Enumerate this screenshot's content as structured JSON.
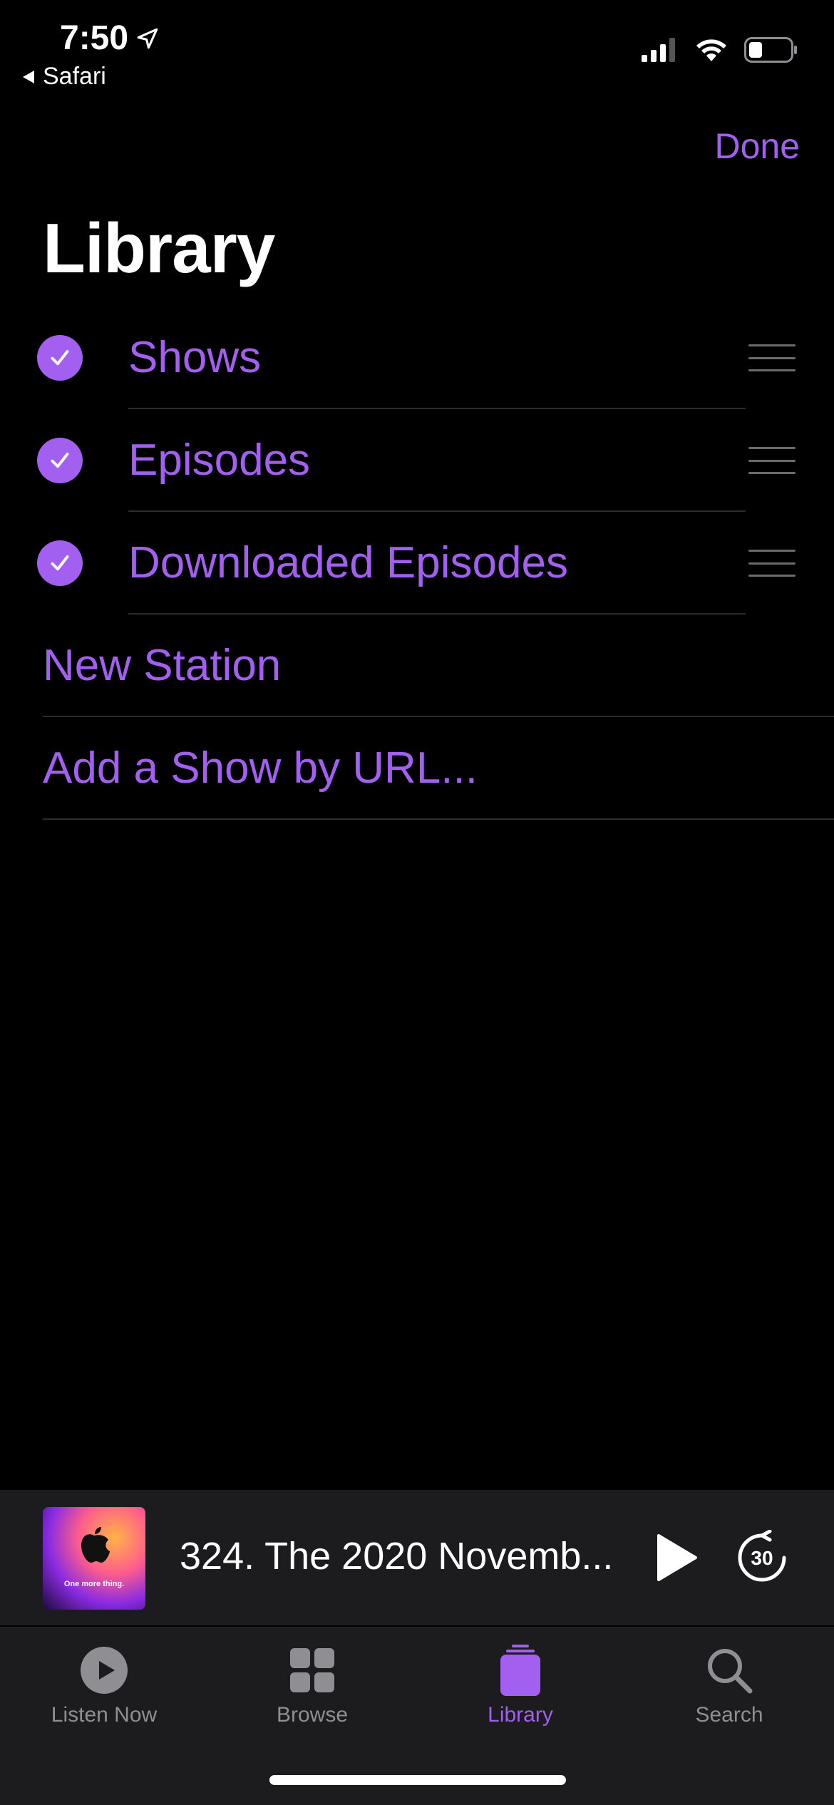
{
  "status_bar": {
    "time": "7:50",
    "back_app": "Safari"
  },
  "header": {
    "done_label": "Done",
    "title": "Library"
  },
  "library_items": [
    {
      "label": "Shows",
      "checked": true
    },
    {
      "label": "Episodes",
      "checked": true
    },
    {
      "label": "Downloaded Episodes",
      "checked": true
    }
  ],
  "actions": {
    "new_station": "New Station",
    "add_show_by_url": "Add a Show by URL..."
  },
  "mini_player": {
    "episode_title": "324. The 2020 Novemb...",
    "artwork_text": "One more thing.",
    "skip_seconds": "30"
  },
  "tab_bar": {
    "tabs": [
      {
        "label": "Listen Now",
        "icon": "play-circle-icon"
      },
      {
        "label": "Browse",
        "icon": "grid-icon"
      },
      {
        "label": "Library",
        "icon": "library-icon"
      },
      {
        "label": "Search",
        "icon": "search-icon"
      }
    ],
    "active": "Library"
  },
  "colors": {
    "accent": "#a35ff0",
    "background": "#000000",
    "bar_background": "#1c1c1e",
    "inactive": "#8e8e93"
  }
}
